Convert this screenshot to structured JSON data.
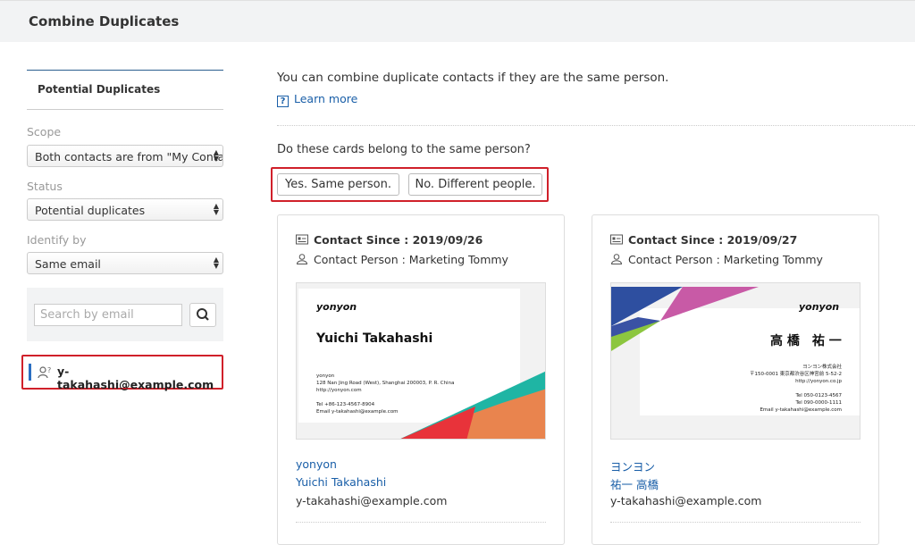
{
  "header": {
    "title": "Combine Duplicates"
  },
  "sidebar": {
    "tab": "Potential Duplicates",
    "scope": {
      "label": "Scope",
      "value": "Both contacts are from \"My Conta"
    },
    "status": {
      "label": "Status",
      "value": "Potential duplicates"
    },
    "identify": {
      "label": "Identify by",
      "value": "Same email"
    },
    "search": {
      "placeholder": "Search by email"
    },
    "result": {
      "email": "y-takahashi@example.com"
    }
  },
  "main": {
    "intro": "You can combine duplicate contacts if they are the same person.",
    "learn_more": "Learn more",
    "question": "Do these cards belong to the same person?",
    "yes_label": "Yes. Same person.",
    "no_label": "No. Different people.",
    "cards": [
      {
        "since": "Contact Since : 2019/09/26",
        "person": "Contact Person : Marketing Tommy",
        "company": "yonyon",
        "name": "Yuichi Takahashi",
        "email": "y-takahashi@example.com",
        "bc": {
          "logo": "yonyon",
          "name": "Yuichi Takahashi",
          "line1": "yonyon",
          "line2": "128 Nan Jing Road (West), Shanghai 200003, P. R. China",
          "line3": "http://yonyon.com",
          "tel": "Tel +86-123-4567-8904",
          "email": "Email  y-takahashi@example.com"
        }
      },
      {
        "since": "Contact Since : 2019/09/27",
        "person": "Contact Person : Marketing Tommy",
        "company": "ヨンヨン",
        "name": "祐一 高橋",
        "email": "y-takahashi@example.com",
        "bc": {
          "logo": "yonyon",
          "name": "高 橋　祐 一",
          "line1": "ヨンヨン株式会社",
          "line2": "〒150-0001 東京都渋谷区神宮前 5-52-2",
          "line3": "http://yonyon.co.jp",
          "tel": "Tel 050-0123-4567",
          "fax": "Tel 090-0000-1111",
          "email": "Email  y-takahashi@example.com"
        }
      }
    ]
  },
  "colors": {
    "accent": "#1a5fa8",
    "highlight": "#d0202a",
    "header_bg": "#f2f3f4"
  },
  "icons": [
    "help-icon",
    "contact-card-icon",
    "person-icon",
    "search-icon",
    "duplicate-user-icon",
    "select-arrows-icon"
  ]
}
